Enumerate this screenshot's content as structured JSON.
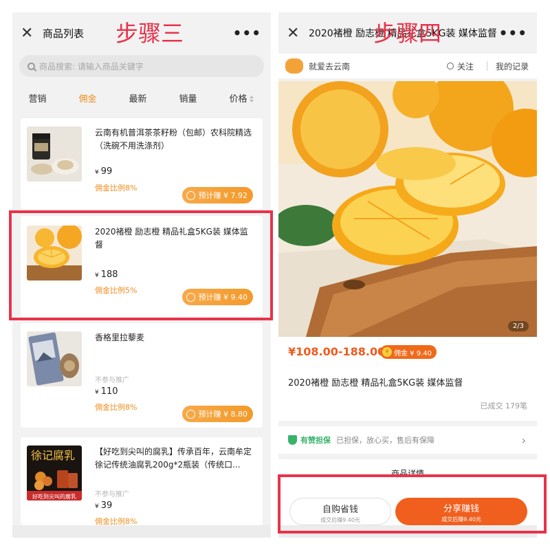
{
  "left": {
    "title": "商品列表",
    "step": "步骤三",
    "search_placeholder": "商品搜索: 请输入商品关键字",
    "tabs": [
      "营销",
      "佣金",
      "最新",
      "销量",
      "价格"
    ],
    "active_tab": "佣金",
    "products": [
      {
        "name": "云南有机普洱茶茶籽粉（包邮）农科院精选（洗碗不用洗涤剂）",
        "price": "99",
        "rate": "佣金比例8%",
        "earn": "预计赚 ¥ 7.92",
        "no_promo": ""
      },
      {
        "name": "2020褚橙 励志橙 精品礼盒5KG装 媒体监督",
        "price": "188",
        "rate": "佣金比例5%",
        "earn": "预计赚 ¥ 9.40",
        "no_promo": ""
      },
      {
        "name": "香格里拉藜麦",
        "price": "110",
        "rate": "佣金比例8%",
        "earn": "预计赚 ¥ 8.80",
        "no_promo": "不参与推广"
      },
      {
        "name": "【好吃到尖叫的腐乳】传承百年，云南牟定徐记传统油腐乳200g*2瓶装（传统口...",
        "price": "39",
        "rate": "佣金比例8%",
        "earn": "",
        "no_promo": "不参与推广"
      }
    ],
    "yen": "¥"
  },
  "right": {
    "title": "2020褚橙 励志橙 精品礼盒5KG装 媒体监督",
    "step": "步骤四",
    "shop_name": "就爱去云南",
    "follow": "关注",
    "records": "我的记录",
    "pager": "2/3",
    "price_range": "¥108.00-188.00",
    "commission": "佣金 ¥ 9.40",
    "product_title": "2020褚橙 励志橙 精品礼盒5KG装 媒体监督",
    "sold": "已成交 179笔",
    "guarantee_name": "有赞担保",
    "guarantee_desc": "已担保，放心买，售后有保障",
    "details_head": "商品详情",
    "self_buy": "自购省钱",
    "self_buy_sub": "成交后赚9.40元",
    "share": "分享赚钱",
    "share_sub": "成交后赚9.40元"
  },
  "colors": {
    "accent_orange": "#f08c1c",
    "highlight_red": "#e8324a",
    "share_orange": "#f05f1e",
    "guarantee_green": "#38b36a"
  }
}
